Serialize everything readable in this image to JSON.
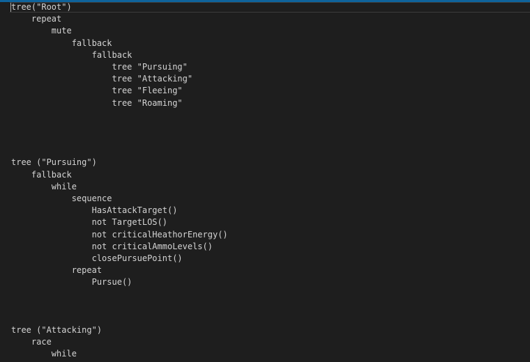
{
  "editor": {
    "lines": [
      "tree(\"Root\")",
      "    repeat",
      "        mute",
      "            fallback",
      "                fallback",
      "                    tree \"Pursuing\"",
      "                    tree \"Attacking\"",
      "                    tree \"Fleeing\"",
      "                    tree \"Roaming\"",
      "",
      "",
      "",
      "",
      "tree (\"Pursuing\")",
      "    fallback",
      "        while",
      "            sequence",
      "                HasAttackTarget()",
      "                not TargetLOS()",
      "                not criticalHeathorEnergy()",
      "                not criticalAmmoLevels()",
      "                closePursuePoint()",
      "            repeat",
      "                Pursue()",
      "",
      "",
      "",
      "tree (\"Attacking\")",
      "    race",
      "        while"
    ]
  },
  "colors": {
    "background": "#1e1e1e",
    "text": "#d4d4d4",
    "accent": "#0e639c",
    "current_line_border": "#3c3c3c"
  }
}
